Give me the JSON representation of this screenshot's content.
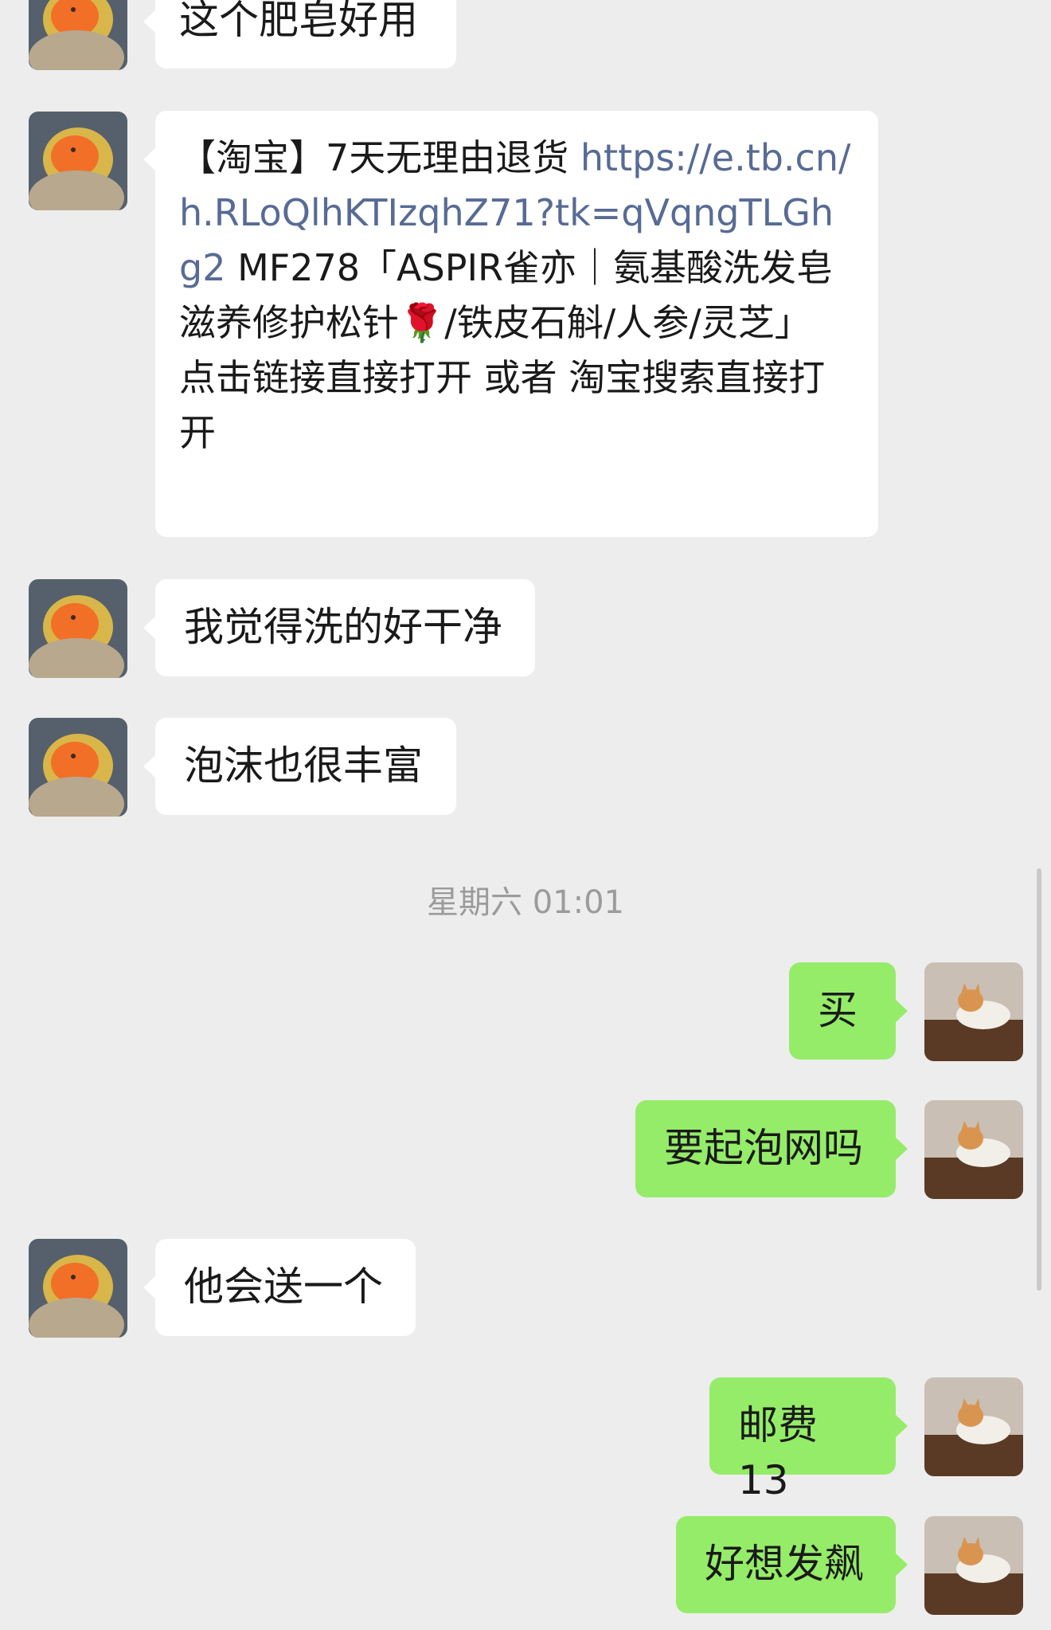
{
  "app": {
    "name": "WeChat chat"
  },
  "messages": [
    {
      "side": "in",
      "text": "这个肥皂好用"
    },
    {
      "side": "in",
      "parts": [
        {
          "type": "text",
          "text": "【淘宝】7天无理由退货 "
        },
        {
          "type": "link",
          "text": "https://e.tb.cn/h.RLoQlhKTIzqhZ71?tk=qVqngTLGhg2"
        },
        {
          "type": "text",
          "text": " MF278「ASPIR雀亦｜氨基酸洗发皂滋养修护松针"
        },
        {
          "type": "emoji",
          "text": "🌹"
        },
        {
          "type": "text",
          "text": "/铁皮石斛/人参/灵芝」"
        },
        {
          "type": "text",
          "text": "点击链接直接打开 或者 淘宝搜索直接打开"
        }
      ]
    },
    {
      "side": "in",
      "text": "我觉得洗的好干净"
    },
    {
      "side": "in",
      "text": "泡沫也很丰富"
    },
    {
      "side": "out",
      "text": "买"
    },
    {
      "side": "out",
      "text": "要起泡网吗"
    },
    {
      "side": "in",
      "text": "他会送一个"
    },
    {
      "side": "out",
      "text": "邮费 13"
    },
    {
      "side": "out",
      "text": "好想发飙"
    }
  ],
  "timestamp": "星期六 01:01",
  "avatars": {
    "incoming": "duck-plush-avatar",
    "outgoing": "cat-photo-avatar"
  },
  "colors": {
    "background": "#ededed",
    "incoming_bubble": "#ffffff",
    "outgoing_bubble": "#95ec69",
    "link": "#576b95",
    "timestamp": "#9b9b9b"
  }
}
